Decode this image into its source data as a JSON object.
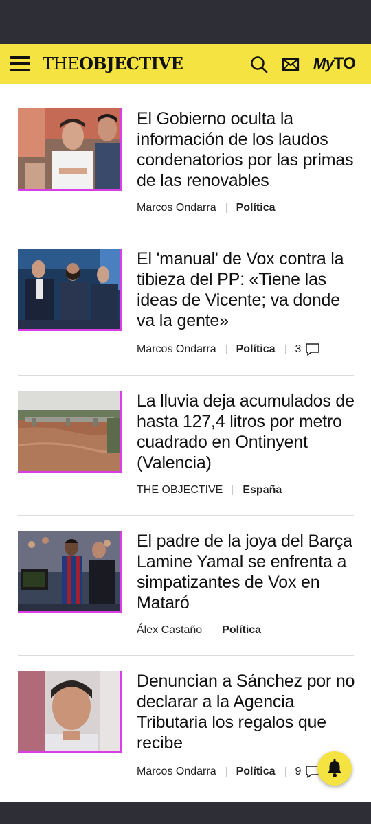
{
  "header": {
    "logo_the": "THE",
    "logo_objective": "OBJECTIVE",
    "myto_my": "My",
    "myto_to": "TO",
    "icons": [
      "menu-icon",
      "search-icon",
      "mail-icon"
    ]
  },
  "colors": {
    "brand_yellow": "#f5e342",
    "accent_magenta": "#d93ee6",
    "system_bar": "#2e2e36"
  },
  "articles": [
    {
      "title": "El Gobierno oculta la información de los laudos condenatorios por las primas de las renovables",
      "author": "Marcos Ondarra",
      "section": "Política",
      "comments": ""
    },
    {
      "title": "El 'manual' de Vox contra la tibieza del PP: «Tiene las ideas de Vicente; va donde va la gente»",
      "author": "Marcos Ondarra",
      "section": "Política",
      "comments": "3"
    },
    {
      "title": "La lluvia deja acumulados de hasta 127,4 litros por metro cuadrado en Ontinyent (Valencia)",
      "author": "THE OBJECTIVE",
      "section": "España",
      "comments": ""
    },
    {
      "title": "El padre de la joya del Barça Lamine Yamal se enfrenta a simpatizantes de Vox en Mataró",
      "author": "Álex Castaño",
      "section": "Política",
      "comments": ""
    },
    {
      "title": "Denuncian a Sánchez por no declarar a la Agencia Tributaria los regalos que recibe",
      "author": "Marcos Ondarra",
      "section": "Política",
      "comments": "9"
    }
  ]
}
